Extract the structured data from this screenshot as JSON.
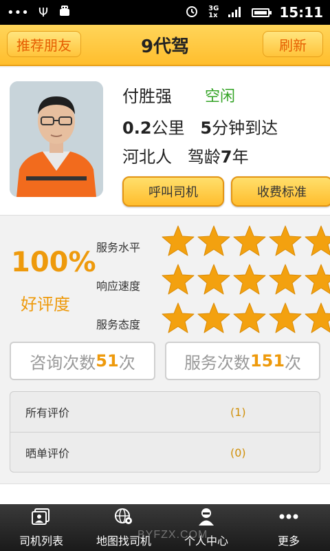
{
  "status_bar": {
    "time": "15:11",
    "network": "3G",
    "network2": "1x",
    "icons": [
      "more-dots-icon",
      "usb-icon",
      "android-debug-icon",
      "alarm-icon",
      "signal-icon",
      "battery-icon"
    ]
  },
  "header": {
    "title": "9代驾",
    "left_button": "推荐朋友",
    "right_button": "刷新"
  },
  "profile": {
    "name": "付胜强",
    "status": "空闲",
    "distance_value": "0.2",
    "distance_unit": "公里",
    "eta_value": "5",
    "eta_unit": "分钟到达",
    "hometown": "河北人",
    "driving_label": "驾龄",
    "driving_years": "7",
    "driving_unit": "年",
    "call_button": "呼叫司机",
    "fee_button": "收费标准"
  },
  "rating": {
    "percent": "100%",
    "percent_label": "好评度",
    "items": [
      {
        "label": "服务水平",
        "stars": 5
      },
      {
        "label": "响应速度",
        "stars": 5
      },
      {
        "label": "服务态度",
        "stars": 5
      }
    ],
    "star_color": "#f3a10f"
  },
  "counts": {
    "consult_label": "咨询次数",
    "consult_value": "51",
    "consult_unit": "次",
    "service_label": "服务次数",
    "service_value": "151",
    "service_unit": "次"
  },
  "reviews": [
    {
      "label": "所有评价",
      "count": "(1)"
    },
    {
      "label": "晒单评价",
      "count": "(0)"
    }
  ],
  "bottom_nav": [
    {
      "label": "司机列表",
      "icon": "driver-list-icon"
    },
    {
      "label": "地图找司机",
      "icon": "map-globe-icon"
    },
    {
      "label": "个人中心",
      "icon": "person-icon"
    },
    {
      "label": "更多",
      "icon": "more-dots-icon"
    }
  ],
  "watermark": "BYFZX.COM",
  "colors": {
    "accent": "#ffc43a",
    "accent_text": "#ee9a0c",
    "available": "#33a325"
  }
}
